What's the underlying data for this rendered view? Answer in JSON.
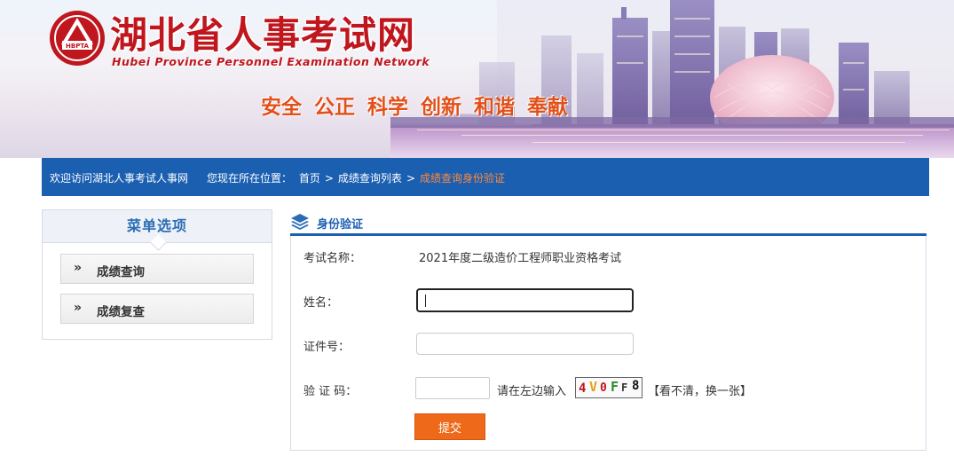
{
  "header": {
    "logo_text": "HBPTA",
    "title": "湖北省人事考试网",
    "subtitle": "Hubei Province Personnel Examination Network",
    "slogan": "安全 公正 科学 创新 和谐 奉献"
  },
  "navbar": {
    "welcome": "欢迎访问湖北人事考试人事网",
    "location_label": "您现在所在位置：",
    "breadcrumb": [
      "首页",
      "成绩查询列表",
      "成绩查询身份验证"
    ],
    "separator": ">"
  },
  "sidebar": {
    "title": "菜单选项",
    "items": [
      {
        "label": "成绩查询",
        "icon": "double-chevron-right-icon"
      },
      {
        "label": "成绩复查",
        "icon": "double-chevron-right-icon"
      }
    ]
  },
  "panel": {
    "title": "身份验证",
    "icon": "layers-icon"
  },
  "form": {
    "exam_name_label": "考试名称：",
    "exam_name_value": "2021年度二级造价工程师职业资格考试",
    "name_label": "姓名：",
    "name_value": "",
    "id_label": "证件号：",
    "id_value": "",
    "captcha_label": "验 证 码：",
    "captcha_value": "",
    "captcha_hint": "请在左边输入",
    "captcha_chars": [
      {
        "char": "4",
        "color": "#c0161e"
      },
      {
        "char": "V",
        "color": "#e6a01a"
      },
      {
        "char": "0",
        "color": "#c0161e"
      },
      {
        "char": "F",
        "color": "#2a8a2a"
      },
      {
        "char": "F",
        "color": "#333333"
      },
      {
        "char": "8",
        "color": "#111111"
      }
    ],
    "refresh_link": "【看不清，换一张】",
    "submit_label": "提交"
  },
  "colors": {
    "brand_red": "#c0161e",
    "nav_blue": "#1b5fb1",
    "breadcrumb_current": "#ff8a3a",
    "submit_orange": "#ee6a1a"
  }
}
